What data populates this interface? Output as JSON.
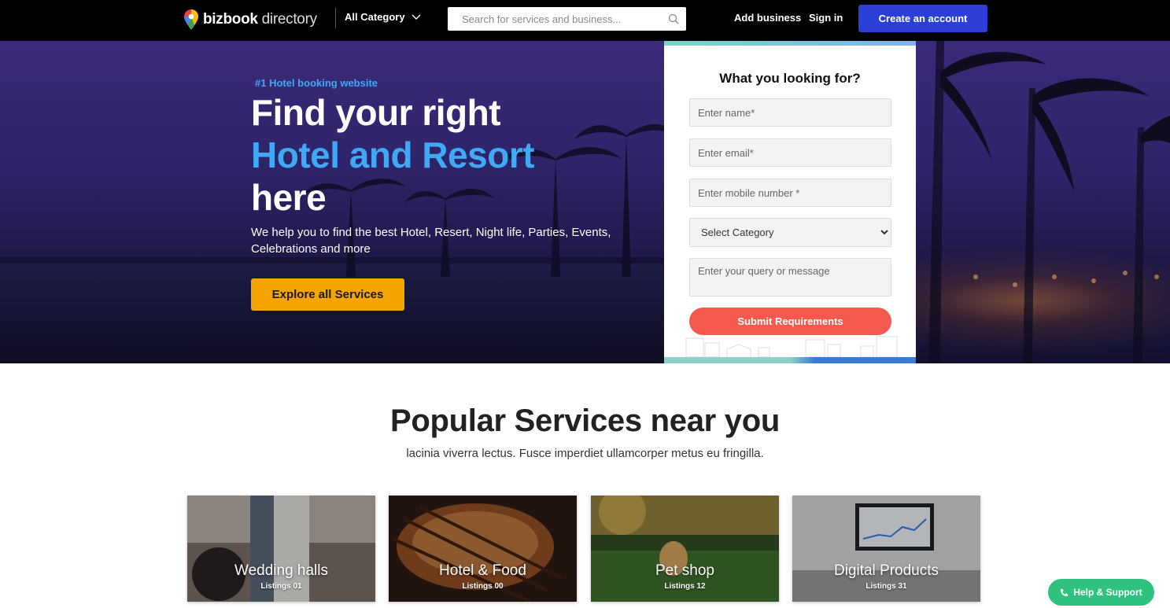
{
  "header": {
    "logo_bold": "bizbook",
    "logo_light": " directory",
    "category_label": "All Category",
    "search_placeholder": "Search for services and business...",
    "add_business": "Add business",
    "sign_in": "Sign in",
    "create_account": "Create an account"
  },
  "hero": {
    "tag": "#1 Hotel booking website",
    "heading_line1": "Find your right",
    "heading_accent": "Hotel and Resort",
    "heading_line3": "here",
    "subtitle": "We help you to find the best Hotel, Resert, Night life, Parties, Events, Celebrations and more",
    "explore_button": "Explore all Services"
  },
  "form": {
    "title": "What you looking for?",
    "name_placeholder": "Enter name*",
    "email_placeholder": "Enter email*",
    "mobile_placeholder": "Enter mobile number *",
    "category_selected": "Select Category",
    "message_placeholder": "Enter your query or message",
    "submit_label": "Submit Requirements"
  },
  "popular": {
    "title_bold": "Popular Services",
    "title_light": " near you",
    "subtitle": "lacinia viverra lectus. Fusce imperdiet ullamcorper metus eu fringilla.",
    "cards": [
      {
        "title": "Wedding halls",
        "count": "Listings 01"
      },
      {
        "title": "Hotel & Food",
        "count": "Listings 00"
      },
      {
        "title": "Pet shop",
        "count": "Listings 12"
      },
      {
        "title": "Digital Products",
        "count": "Listings 31"
      }
    ]
  },
  "help": {
    "label": "Help & Support"
  },
  "colors": {
    "accent_blue": "#3fa9f5",
    "create_button": "#2b3fd6",
    "explore_button": "#f5a400",
    "submit_button": "#f45a4f",
    "help_button": "#2ec27e"
  }
}
